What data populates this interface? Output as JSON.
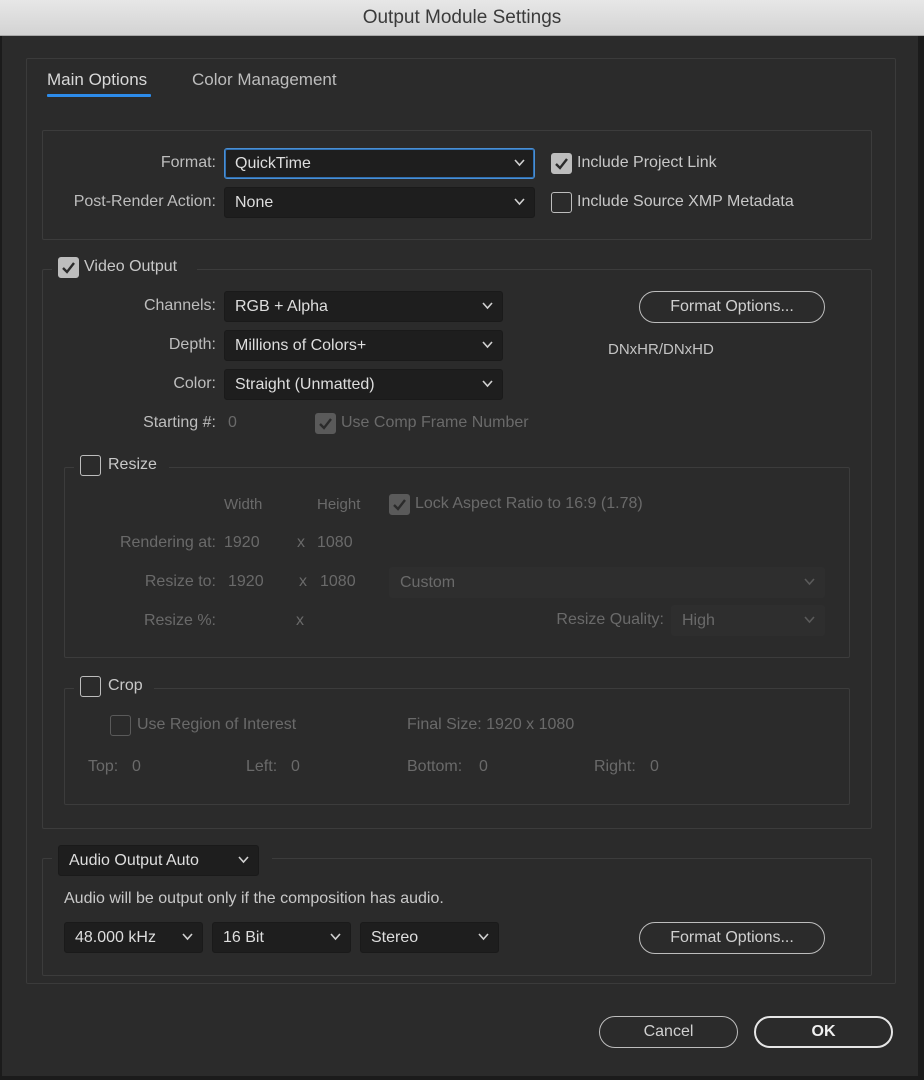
{
  "window": {
    "title": "Output Module Settings"
  },
  "tabs": [
    {
      "label": "Main Options"
    },
    {
      "label": "Color Management"
    }
  ],
  "format_section": {
    "format_label": "Format:",
    "format_value": "QuickTime",
    "post_render_label": "Post-Render Action:",
    "post_render_value": "None",
    "include_project_link": {
      "label": "Include Project Link",
      "checked": true
    },
    "include_xmp": {
      "label": "Include Source XMP Metadata",
      "checked": false
    }
  },
  "video": {
    "video_output": {
      "label": "Video Output",
      "checked": true
    },
    "channels_label": "Channels:",
    "channels_value": "RGB + Alpha",
    "depth_label": "Depth:",
    "depth_value": "Millions of Colors+",
    "color_label": "Color:",
    "color_value": "Straight (Unmatted)",
    "starting_label": "Starting #:",
    "starting_value": "0",
    "use_comp_frame": {
      "label": "Use Comp Frame Number",
      "checked": true
    },
    "format_options_label": "Format Options...",
    "codec_text": "DNxHR/DNxHD"
  },
  "resize": {
    "label": "Resize",
    "checked": false,
    "width_header": "Width",
    "height_header": "Height",
    "lock_aspect": {
      "label": "Lock Aspect Ratio to 16:9 (1.78)",
      "checked": true
    },
    "rendering_at_label": "Rendering at:",
    "rendering_width": "1920",
    "rendering_height": "1080",
    "resize_to_label": "Resize to:",
    "resize_width": "1920",
    "resize_height": "1080",
    "preset_value": "Custom",
    "resize_percent_label": "Resize %:",
    "x_symbol": "x",
    "quality_label": "Resize Quality:",
    "quality_value": "High"
  },
  "crop": {
    "label": "Crop",
    "checked": false,
    "use_roi": {
      "label": "Use Region of Interest",
      "checked": false
    },
    "final_size": "Final Size: 1920 x 1080",
    "top_label": "Top:",
    "top_value": "0",
    "left_label": "Left:",
    "left_value": "0",
    "bottom_label": "Bottom:",
    "bottom_value": "0",
    "right_label": "Right:",
    "right_value": "0"
  },
  "audio": {
    "mode_value": "Audio Output Auto",
    "note": "Audio will be output only if the composition has audio.",
    "sample_rate": "48.000 kHz",
    "bit_depth": "16 Bit",
    "channels": "Stereo",
    "format_options_label": "Format Options..."
  },
  "footer": {
    "cancel_label": "Cancel",
    "ok_label": "OK"
  },
  "colors": {
    "accent": "#2d8ceb",
    "window_bg": "#2b2b2b",
    "field_bg": "#1e1e1e"
  }
}
